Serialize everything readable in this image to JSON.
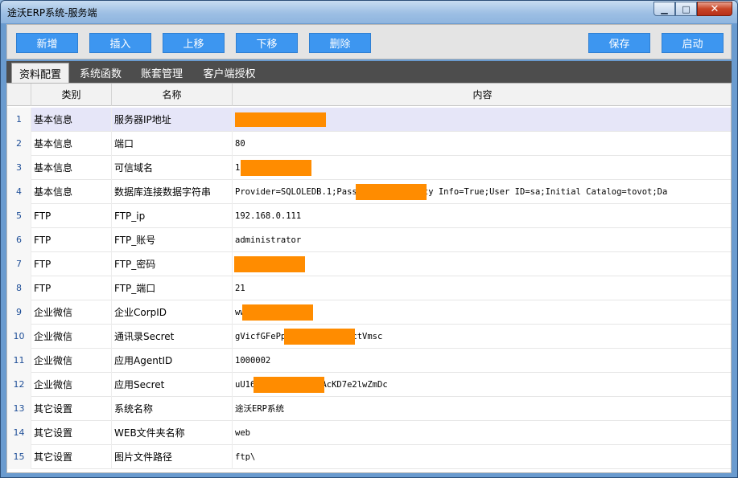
{
  "window": {
    "title": "途沃ERP系统-服务端"
  },
  "window_controls": {
    "minimize": "▁",
    "maximize": "□",
    "close": "✕"
  },
  "toolbar": {
    "add": "新增",
    "insert": "插入",
    "move_up": "上移",
    "move_down": "下移",
    "delete": "删除",
    "save": "保存",
    "start": "启动"
  },
  "tabs": [
    "资料配置",
    "系统函数",
    "账套管理",
    "客户端授权"
  ],
  "active_tab": "资料配置",
  "grid": {
    "headers": [
      "",
      "类别",
      "名称",
      "内容"
    ],
    "rows": [
      {
        "idx": "1",
        "category": "基本信息",
        "name": "服务器IP地址",
        "value": ""
      },
      {
        "idx": "2",
        "category": "基本信息",
        "name": "端口",
        "value": "80"
      },
      {
        "idx": "3",
        "category": "基本信息",
        "name": "可信域名",
        "value": "1                  in"
      },
      {
        "idx": "4",
        "category": "基本信息",
        "name": "数据库连接数据字符串",
        "value": "Provider=SQLOLEDB.1;Passw                   sist  Security  Info=True;User  ID=sa;Initial Catalog=tovot;Da"
      },
      {
        "idx": "5",
        "category": "FTP",
        "name": "FTP_ip",
        "value": "192.168.0.111"
      },
      {
        "idx": "6",
        "category": "FTP",
        "name": "FTP_账号",
        "value": "administrator"
      },
      {
        "idx": "7",
        "category": "FTP",
        "name": "FTP_密码",
        "value": ""
      },
      {
        "idx": "8",
        "category": "FTP",
        "name": "FTP_端口",
        "value": "21"
      },
      {
        "idx": "9",
        "category": "企业微信",
        "name": "企业CorpID",
        "value": "ww                  39"
      },
      {
        "idx": "10",
        "category": "企业微信",
        "name": "通讯录Secret",
        "value": "gVicfGFePp                  KQC-rfMuTTrIctVmsc"
      },
      {
        "idx": "11",
        "category": "企业微信",
        "name": "应用AgentID",
        "value": "1000002"
      },
      {
        "idx": "12",
        "category": "企业微信",
        "name": "应用Secret",
        "value": "uU16                  GuWW1TJaDt8aAcKD7e2lwZmDc"
      },
      {
        "idx": "13",
        "category": "其它设置",
        "name": "系统名称",
        "value": "途沃ERP系统"
      },
      {
        "idx": "14",
        "category": "其它设置",
        "name": "WEB文件夹名称",
        "value": "web"
      },
      {
        "idx": "15",
        "category": "其它设置",
        "name": "图片文件路径",
        "value": "ftp\\"
      }
    ]
  },
  "colors": {
    "button_blue": "#3d96f0",
    "tab_bar": "#4d4d4d",
    "selected_row": "#e6e6f8",
    "redaction": "#ff8c00"
  }
}
